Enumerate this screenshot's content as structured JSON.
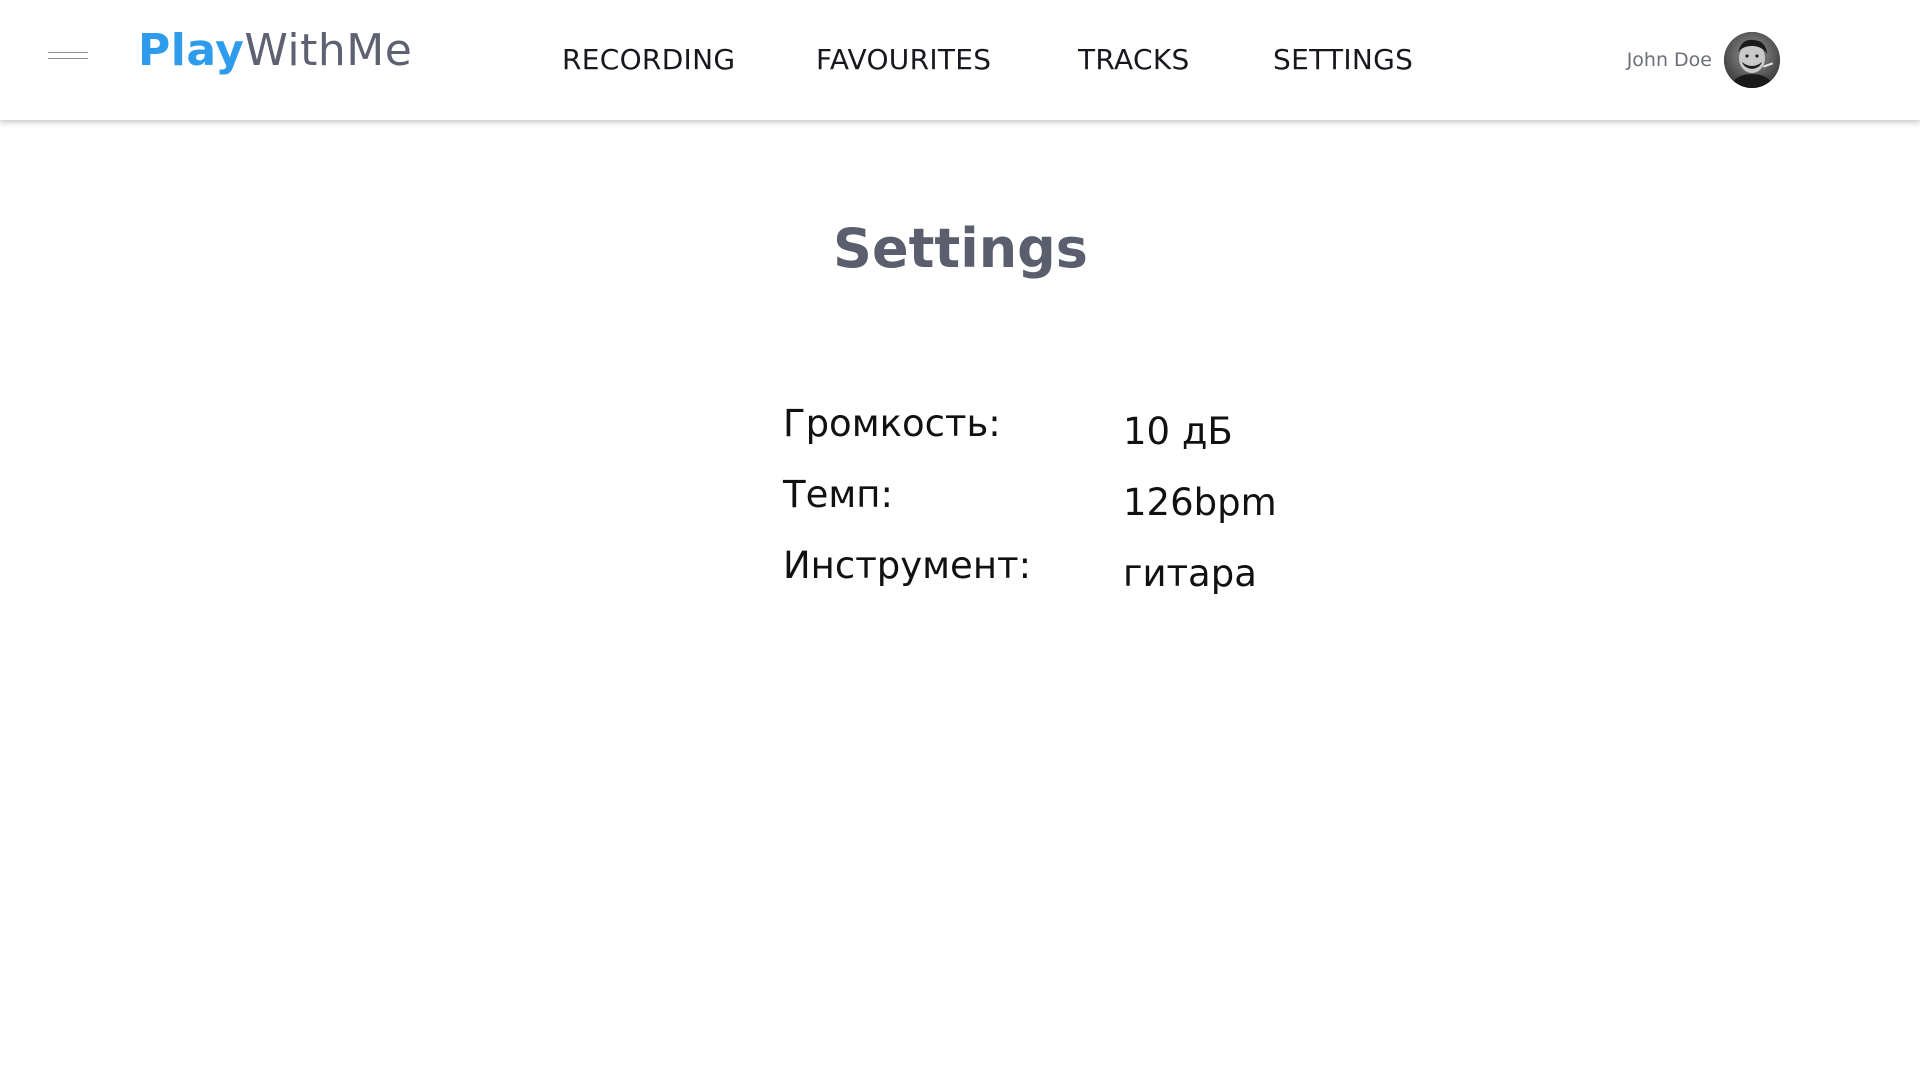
{
  "header": {
    "logo": {
      "play": "Play",
      "rest": "WithMe"
    },
    "nav": [
      {
        "label": "RECORDING"
      },
      {
        "label": "FAVOURITES"
      },
      {
        "label": "TRACKS"
      },
      {
        "label": "SETTINGS"
      }
    ],
    "user": {
      "name": "John Doe"
    }
  },
  "main": {
    "title": "Settings",
    "settings": [
      {
        "label": "Громкость:",
        "value": "10 дБ"
      },
      {
        "label": "Темп:",
        "value": "126bpm"
      },
      {
        "label": "Инструмент:",
        "value": "гитара"
      }
    ]
  },
  "colors": {
    "brand_blue": "#2d9cec",
    "logo_gray": "#5d6171",
    "title_gray": "#5a5e6d",
    "text": "#111111"
  },
  "icons": {
    "menu": "hamburger-icon"
  }
}
